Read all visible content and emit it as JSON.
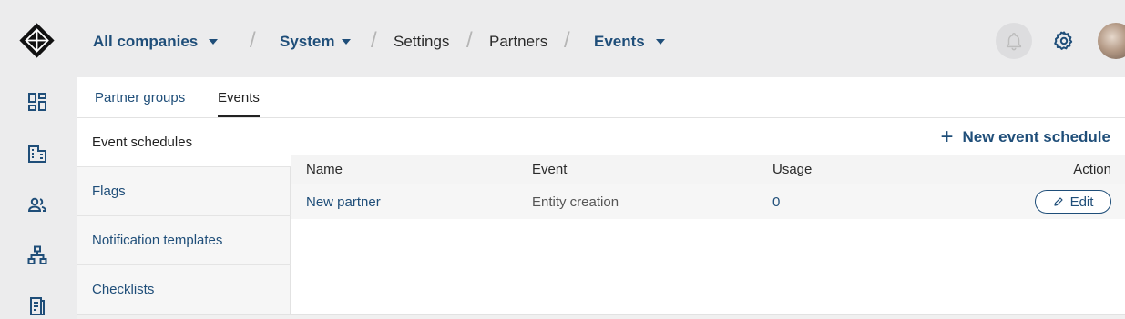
{
  "breadcrumb": {
    "company": "All companies",
    "system": "System",
    "settings": "Settings",
    "partners": "Partners",
    "events": "Events",
    "separator": "/"
  },
  "tabs": [
    {
      "label": "Partner groups",
      "active": false
    },
    {
      "label": "Events",
      "active": true
    }
  ],
  "leftnav": {
    "items": [
      {
        "label": "Event schedules",
        "active": true
      },
      {
        "label": "Flags",
        "active": false
      },
      {
        "label": "Notification templates",
        "active": false
      },
      {
        "label": "Checklists",
        "active": false
      }
    ]
  },
  "panel": {
    "new_button_label": "New event schedule",
    "columns": {
      "name": "Name",
      "event": "Event",
      "usage": "Usage",
      "action": "Action"
    },
    "rows": [
      {
        "name": "New partner",
        "event": "Entity creation",
        "usage": "0",
        "action": "Edit"
      }
    ]
  },
  "sidebar_icons": [
    "dashboard-icon",
    "companies-icon",
    "users-icon",
    "hierarchy-icon",
    "invoice-icon"
  ],
  "colors": {
    "accent": "#1f4e79",
    "topbar_bg": "#ececed"
  }
}
